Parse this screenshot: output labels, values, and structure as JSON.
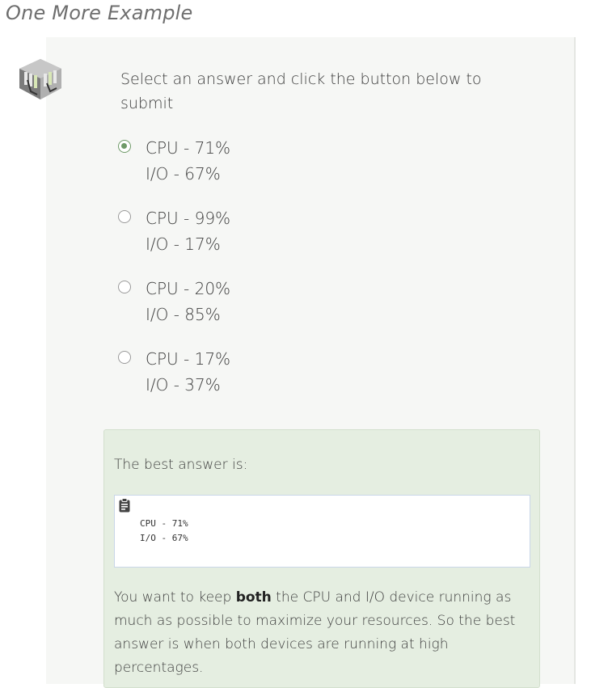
{
  "section": {
    "title": "One More Example"
  },
  "question": {
    "prompt": "Select an answer and click the button below to submit",
    "avatar_icon": "hardware-device-icon",
    "options": [
      {
        "line1": "CPU - 71%",
        "line2": "I/O - 67%",
        "selected": true
      },
      {
        "line1": "CPU - 99%",
        "line2": "I/O - 17%",
        "selected": false
      },
      {
        "line1": "CPU - 20%",
        "line2": "I/O - 85%",
        "selected": false
      },
      {
        "line1": "CPU - 17%",
        "line2": "I/O - 37%",
        "selected": false
      }
    ]
  },
  "feedback": {
    "title": "The best answer is:",
    "code_line1": "CPU - 71%",
    "code_line2": "I/O - 67%",
    "explain_before": "You want to keep ",
    "explain_bold": "both",
    "explain_after": " the CPU and I/O device running as much as possible to maximize your resources. So the best answer is when both devices are running at high percentages.",
    "accent_color": "#6f9a68",
    "background_color": "#e5eee1"
  }
}
